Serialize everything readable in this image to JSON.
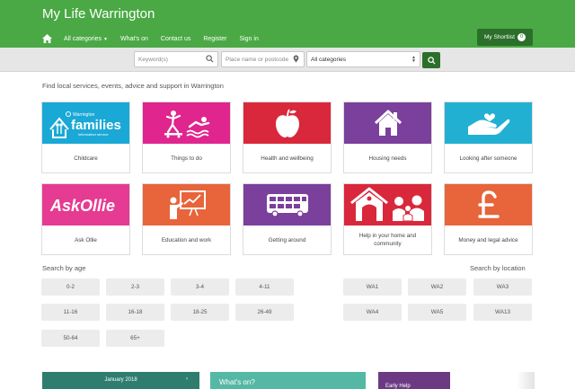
{
  "site": {
    "title": "My Life Warrington"
  },
  "nav": {
    "home_icon": "home-icon",
    "items": [
      "All categories",
      "What's on",
      "Contact us",
      "Register",
      "Sign in"
    ],
    "shortlist_label": "My Shortlist",
    "shortlist_count": "0"
  },
  "search": {
    "keyword_placeholder": "Keyword(s)",
    "location_placeholder": "Place name or postcode",
    "category_selected": "All categories"
  },
  "intro": "Find local services, events, advice and support in Warrington",
  "tiles": [
    {
      "label": "Childcare",
      "color": "#1aa8d6",
      "icon": "families-logo"
    },
    {
      "label": "Things to do",
      "color": "#e0258e",
      "icon": "activities-icon"
    },
    {
      "label": "Health and wellbeing",
      "color": "#d9283b",
      "icon": "apple-icon"
    },
    {
      "label": "Housing needs",
      "color": "#7b3f9c",
      "icon": "house-icon"
    },
    {
      "label": "Looking after someone",
      "color": "#22b0d2",
      "icon": "caring-hand-icon"
    },
    {
      "label": "Ask Ollie",
      "color": "#e53b92",
      "icon": "ask-ollie-logo"
    },
    {
      "label": "Education and work",
      "color": "#e8643a",
      "icon": "teacher-board-icon"
    },
    {
      "label": "Getting around",
      "color": "#7b3f9c",
      "icon": "bus-icon"
    },
    {
      "label": "Help in your home and community",
      "color": "#d9283b",
      "icon": "home-community-icon"
    },
    {
      "label": "Money and legal advice",
      "color": "#e8643a",
      "icon": "pound-icon"
    }
  ],
  "families_logo": {
    "small": "Warrington",
    "big": "families",
    "sub": "information service"
  },
  "ask_ollie_logo": "AskOllie",
  "age": {
    "title": "Search by age",
    "items": [
      "0-2",
      "2-3",
      "3-4",
      "4-11",
      "11-16",
      "16-18",
      "18-25",
      "26-49",
      "50-64",
      "65+"
    ]
  },
  "location": {
    "title": "Search by location",
    "items": [
      "WA1",
      "WA2",
      "WA3",
      "WA4",
      "WA5",
      "WA13"
    ]
  },
  "bottom": {
    "calendar_month": "January 2018",
    "calendar_next": "›",
    "whatson_title": "What's on?",
    "earlyhelp_title": "Early Help"
  }
}
